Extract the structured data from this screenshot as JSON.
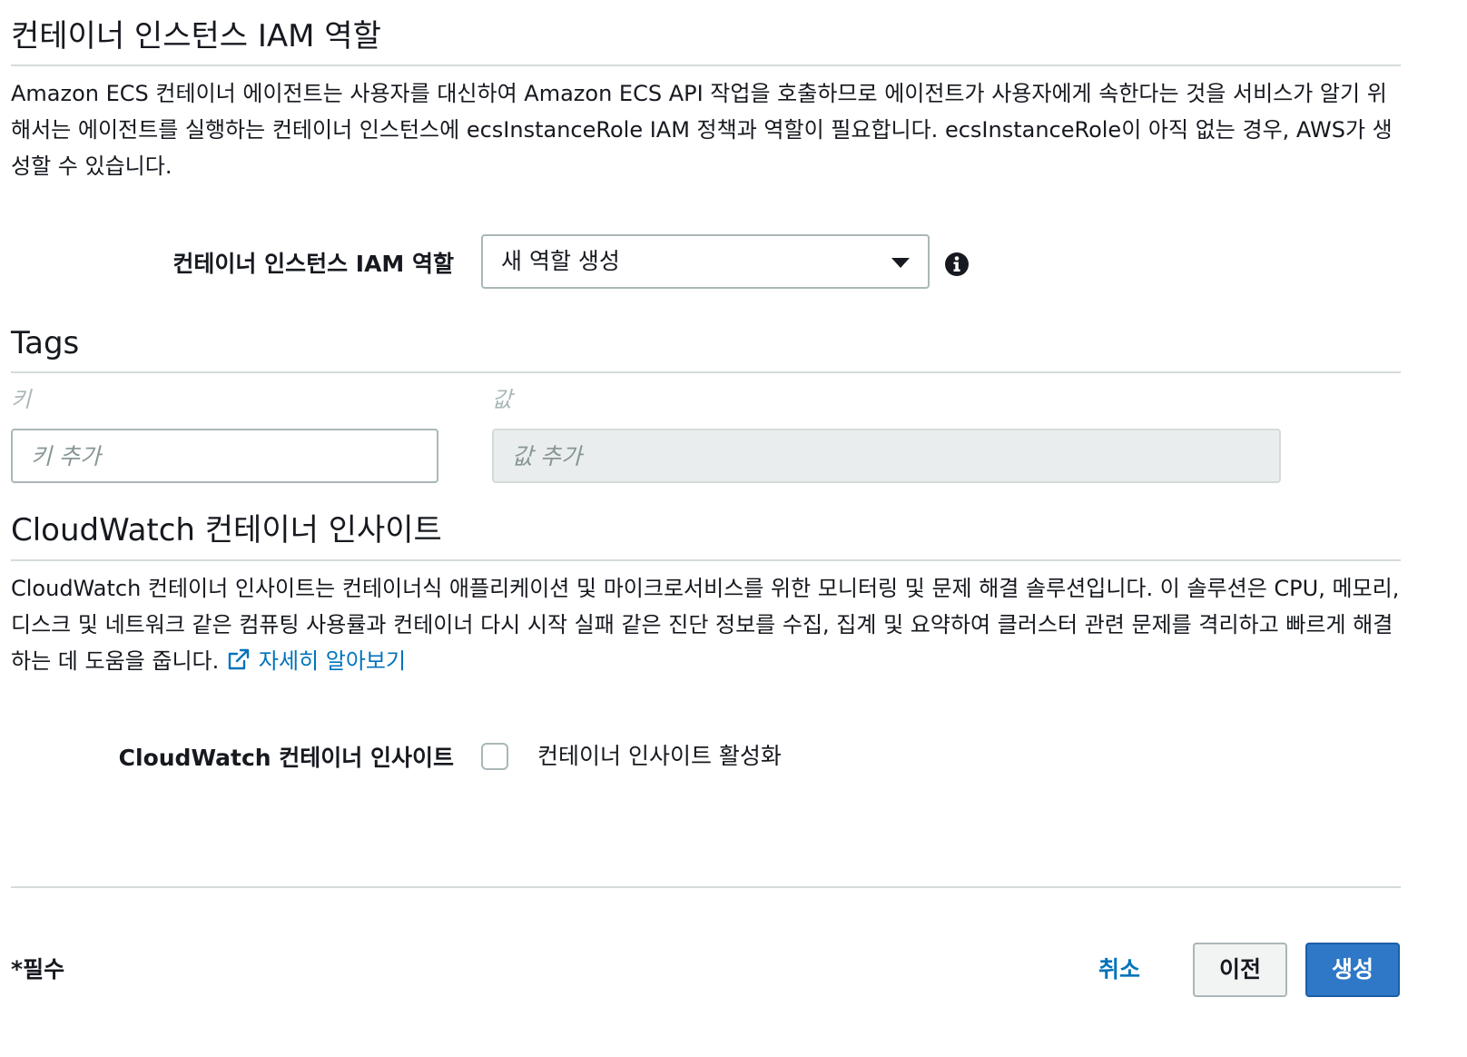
{
  "iam_section": {
    "title": "컨테이너 인스턴스 IAM 역할",
    "description": "Amazon ECS 컨테이너 에이전트는 사용자를 대신하여 Amazon ECS API 작업을 호출하므로 에이전트가 사용자에게 속한다는 것을 서비스가 알기 위해서는 에이전트를 실행하는 컨테이너 인스턴스에 ecsInstanceRole IAM 정책과 역할이 필요합니다. ecsInstanceRole이 아직 없는 경우, AWS가 생성할 수 있습니다.",
    "field_label": "컨테이너 인스턴스 IAM 역할",
    "select_value": "새 역할 생성",
    "info_icon": "info-circle-icon"
  },
  "tags_section": {
    "title": "Tags",
    "key_column": "키",
    "value_column": "값",
    "key_placeholder": "키 추가",
    "value_placeholder": "값 추가"
  },
  "cloudwatch_section": {
    "title": "CloudWatch 컨테이너 인사이트",
    "description": "CloudWatch 컨테이너 인사이트는 컨테이너식 애플리케이션 및 마이크로서비스를 위한 모니터링 및 문제 해결 솔루션입니다. 이 솔루션은 CPU, 메모리, 디스크 및 네트워크 같은 컴퓨팅 사용률과 컨테이너 다시 시작 실패 같은 진단 정보를 수집, 집계 및 요약하여 클러스터 관련 문제를 격리하고 빠르게 해결하는 데 도움을 줍니다.",
    "learn_more": "자세히 알아보기",
    "external_icon": "external-link-icon",
    "field_label": "CloudWatch 컨테이너 인사이트",
    "checkbox_label": "컨테이너 인사이트 활성화",
    "checkbox_checked": false
  },
  "footer": {
    "required_note": "*필수",
    "cancel_label": "취소",
    "previous_label": "이전",
    "create_label": "생성"
  },
  "colors": {
    "link": "#0073bb",
    "primary_button": "#2f78c7",
    "divider": "#d5dbdb",
    "text": "#16191f"
  }
}
